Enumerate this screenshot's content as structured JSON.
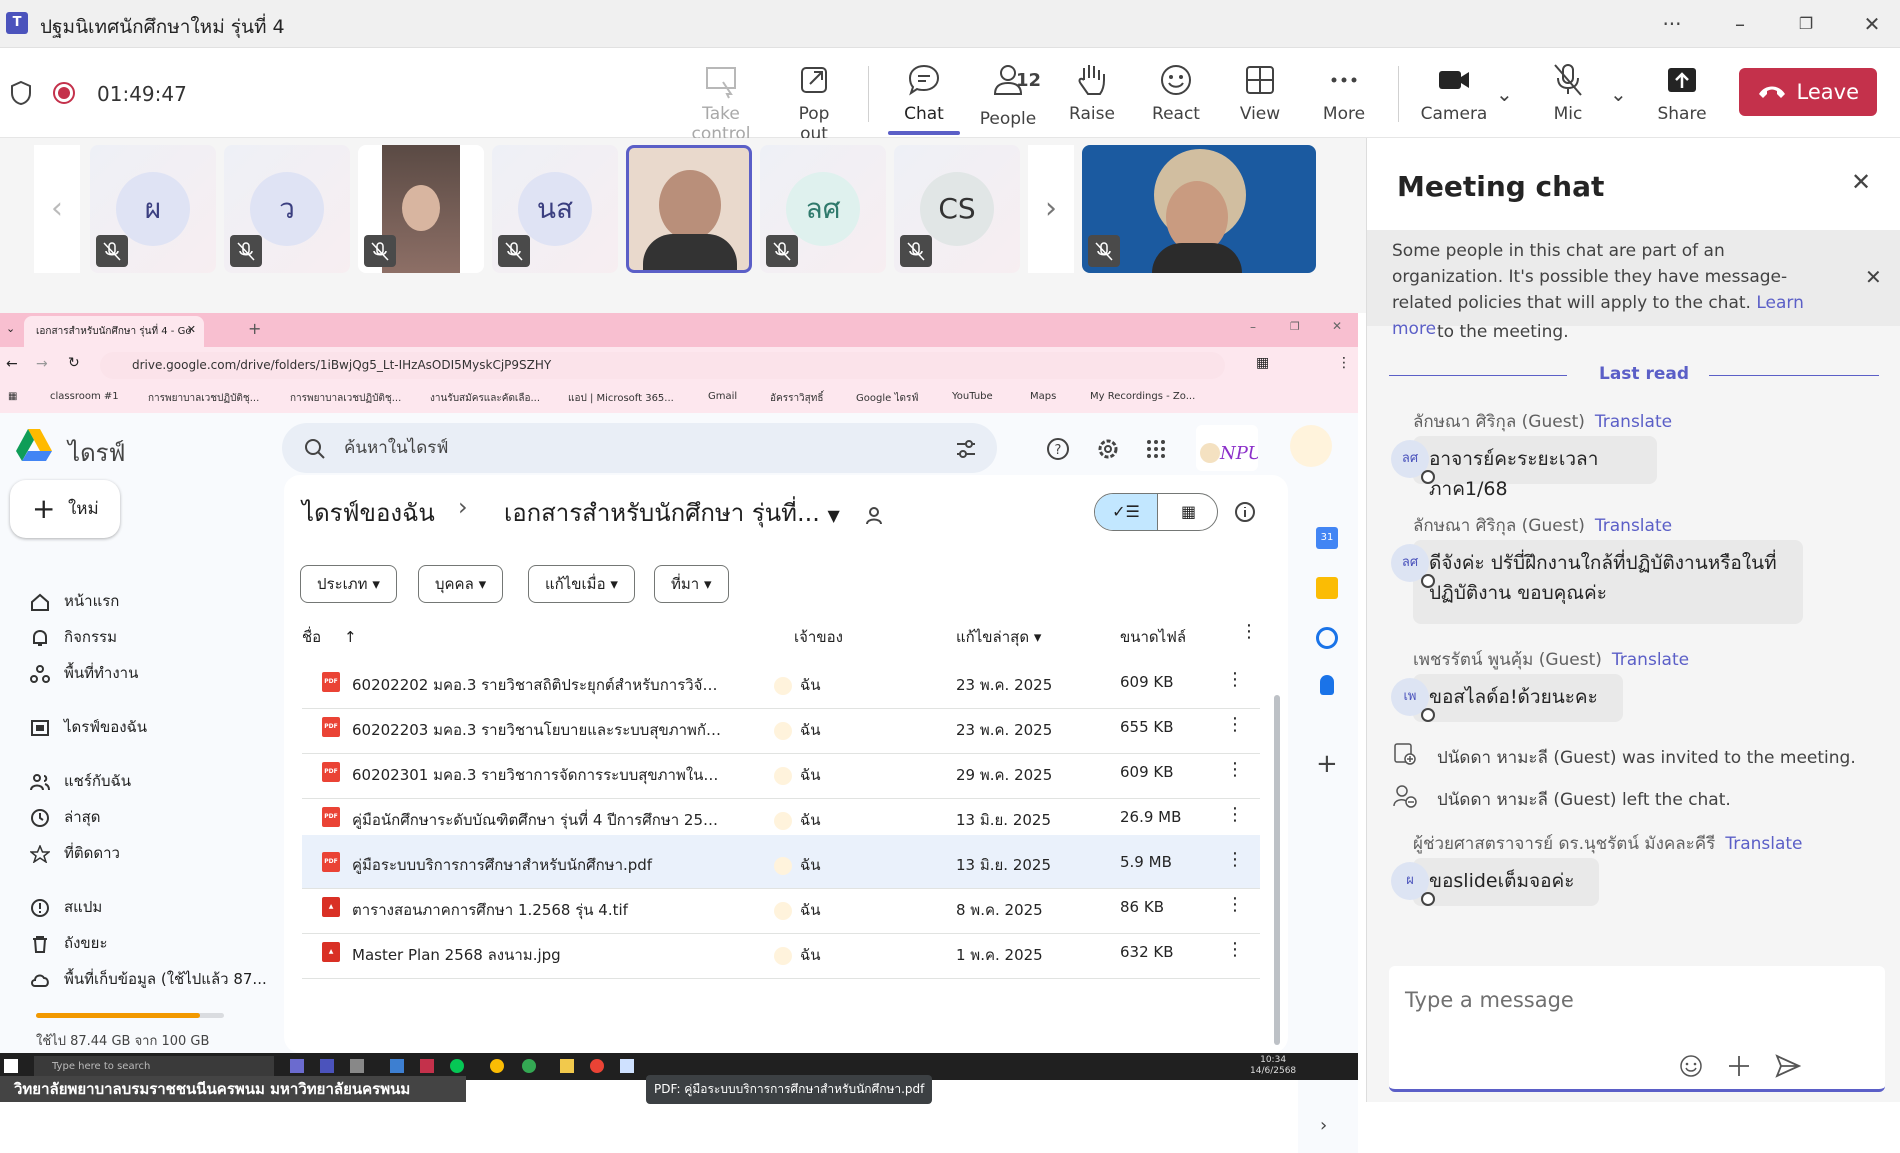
{
  "window": {
    "title": "ปฐมนิเทศนักศึกษาใหม่ รุ่นที่ 4",
    "more": "···"
  },
  "toolbar": {
    "timer": "01:49:47",
    "take_control": "Take control",
    "pop_out": "Pop out",
    "chat": "Chat",
    "people": "People",
    "people_count": "12",
    "raise": "Raise",
    "react": "React",
    "view": "View",
    "more": "More",
    "camera": "Camera",
    "mic": "Mic",
    "share": "Share",
    "leave": "Leave"
  },
  "gallery": {
    "tiles": [
      {
        "initials": "ผ"
      },
      {
        "initials": "ว"
      },
      {
        "initials": ""
      },
      {
        "initials": "นส"
      },
      {
        "initials": ""
      },
      {
        "initials": "ลศ"
      },
      {
        "initials": "CS"
      }
    ]
  },
  "chat": {
    "header": "Meeting chat",
    "notice": "Some people in this chat are part of an organization. It's possible they have message-related policies that will apply to the chat.",
    "learn_more": "Learn more",
    "partial_line": "to the meeting.",
    "last_read": "Last read",
    "translate": "Translate",
    "messages": [
      {
        "sender": "ลักษณา ศิริกุล (Guest)",
        "initials": "ลศ",
        "text": "อาจารย์คะระยะเวลาภาค1/68"
      },
      {
        "sender": "ลักษณา ศิริกุล (Guest)",
        "initials": "ลศ",
        "text": "ดีจังค่ะ ปรับี่ฝึกงานใกล้ที่ปฏิบัติงานหรือในที่ปฏิบัติงาน ขอบคุณค่ะ"
      },
      {
        "sender": "เพชรรัตน์ พูนคุ้ม (Guest)",
        "initials": "เพ",
        "text": "ขอสไลด์อ!ด้วยนะคะ"
      },
      {
        "sender": "ผู้ช่วยศาสตราจารย์ ดร.นุชรัตน์ มังคละคีรี",
        "initials": "ผ",
        "text": "ขอslideเต็มจอค่ะ"
      }
    ],
    "system": [
      "ปนัดดา หามะลี (Guest) was invited to the meeting.",
      "ปนัดดา หามะลี (Guest) left the chat."
    ],
    "compose_placeholder": "Type a message"
  },
  "browser": {
    "tab_title": "เอกสารสำหรับนักศึกษา รุ่นที่ 4 - Go",
    "url": "drive.google.com/drive/folders/1iBwjQg5_Lt-IHzAsODI5MyskCjP9SZHY",
    "bookmarks": [
      "classroom #1",
      "การพยาบาลเวชปฏิบัติชุ...",
      "การพยาบาลเวชปฏิบัติชุ...",
      "งานรับสมัครและคัดเลือ...",
      "แอป | Microsoft 365...",
      "Gmail",
      "อัครราวิสุทธิ์",
      "Google ไดรฟ์",
      "YouTube",
      "Maps",
      "My Recordings - Zo..."
    ]
  },
  "drive": {
    "brand": "ไดรฟ์",
    "search_placeholder": "ค้นหาในไดรฟ์",
    "new_label": "ใหม่",
    "nav": [
      "หน้าแรก",
      "กิจกรรม",
      "พื้นที่ทำงาน",
      "ไดรฟ์ของฉัน",
      "แชร์กับฉัน",
      "ล่าสุด",
      "ที่ติดดาว",
      "สแปม",
      "ถังขยะ",
      "พื้นที่เก็บข้อมูล (ใช้ไปแล้ว 87..."
    ],
    "storage_text": "ใช้ไป 87.44 GB จาก 100 GB",
    "storage_used_fraction": 0.874,
    "breadcrumb_root": "ไดรฟ์ของฉัน",
    "breadcrumb_sep": "›",
    "breadcrumb_folder": "เอกสารสำหรับนักศึกษา รุ่นที่...",
    "filters": [
      "ประเภท",
      "บุคคล",
      "แก้ไขเมื่อ",
      "ที่มา"
    ],
    "columns": {
      "name": "ชื่อ",
      "owner": "เจ้าของ",
      "modified": "แก้ไขล่าสุด",
      "size": "ขนาดไฟล์"
    },
    "files": [
      {
        "name": "60202202 มคอ.3 รายวิชาสถิติประยุกต์สำหรับการวิจัยทาง...",
        "owner": "ฉัน",
        "date": "23 พ.ค. 2025",
        "size": "609 KB",
        "type": "PDF"
      },
      {
        "name": "60202203 มคอ.3 รายวิชานโยบายและระบบสุขภาพกับภา...",
        "owner": "ฉัน",
        "date": "23 พ.ค. 2025",
        "size": "655 KB",
        "type": "PDF"
      },
      {
        "name": "60202301 มคอ.3 รายวิชาการจัดการระบบสุขภาพในชุมช...",
        "owner": "ฉัน",
        "date": "29 พ.ค. 2025",
        "size": "609 KB",
        "type": "PDF"
      },
      {
        "name": "คู่มือนักศึกษาระดับบัณฑิตศึกษา รุ่นที่ 4 ปีการศึกษา 2568.p...",
        "owner": "ฉัน",
        "date": "13 มิ.ย. 2025",
        "size": "26.9 MB",
        "type": "PDF"
      },
      {
        "name": "คู่มือระบบบริการการศึกษาสำหรับนักศึกษา.pdf",
        "owner": "ฉัน",
        "date": "13 มิ.ย. 2025",
        "size": "5.9 MB",
        "type": "PDF"
      },
      {
        "name": "ตารางสอนภาคการศึกษา 1.2568 รุ่น 4.tif",
        "owner": "ฉัน",
        "date": "8 พ.ค. 2025",
        "size": "86 KB",
        "type": "IMG"
      },
      {
        "name": "Master Plan 2568 ลงนาม.jpg",
        "owner": "ฉัน",
        "date": "1 พ.ค. 2025",
        "size": "632 KB",
        "type": "IMG"
      }
    ],
    "tooltip": "PDF: คู่มือระบบบริการการศึกษาสำหรับนักศึกษา.pdf"
  },
  "taskbar": {
    "search": "Type here to search",
    "time": "10:34",
    "date": "14/6/2568"
  },
  "footer": "วิทยาลัยพยาบาลบรมราชชนนีนครพนม มหาวิทยาลัยนครพนม",
  "colors": {
    "accent": "#5b5fc7",
    "leave": "#c4314b",
    "tab_bar": "#f8bfd0"
  }
}
